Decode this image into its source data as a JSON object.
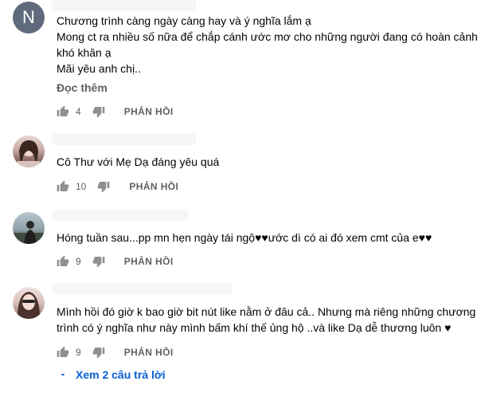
{
  "comments": [
    {
      "avatar_letter": "N",
      "lines": [
        "Chương trình càng ngày càng hay và ý nghĩa lắm ạ",
        "Mong ct ra nhiều số nữa để chắp cánh ước mơ cho những người đang có hoàn cảnh",
        "khó khăn ạ",
        "Mãi yêu anh chị.."
      ],
      "read_more": "Đọc thêm",
      "likes": "4",
      "reply_label": "PHẢN HỒI"
    },
    {
      "lines": [
        "Cô Thư với Mẹ Dạ đáng yêu quá"
      ],
      "likes": "10",
      "reply_label": "PHẢN HỒI"
    },
    {
      "lines": [
        "Hóng tuần sau...pp mn hẹn ngày tái ngộ♥♥ước dì có ai đó xem cmt của e♥♥"
      ],
      "likes": "9",
      "reply_label": "PHẢN HỒI"
    },
    {
      "lines": [
        "Mình hồi đó giờ k bao giờ bit nút like nằm ở đâu cả.. Nhưng mà riêng những chương",
        "trình có ý nghĩa như này mình bấm khí thế ủng hộ ..và like Dạ dễ thương luôn ♥"
      ],
      "likes": "9",
      "reply_label": "PHẢN HỒI"
    }
  ],
  "view_replies": "Xem 2 câu trả lời",
  "colors": {
    "accent": "#065fd4",
    "secondary_text": "#606060",
    "icon": "#909090"
  }
}
